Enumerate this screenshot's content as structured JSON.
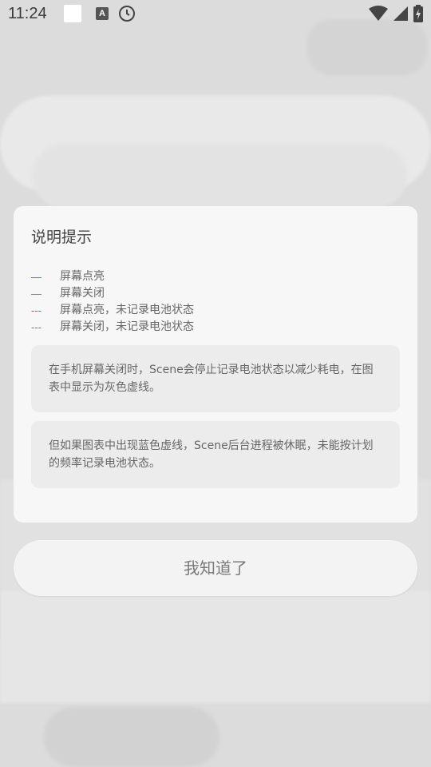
{
  "status_bar": {
    "time": "11:24",
    "a_icon_label": "A"
  },
  "dialog": {
    "title": "说明提示",
    "legend": [
      {
        "line": "—",
        "color": "#3b78d6",
        "label": "屏幕点亮"
      },
      {
        "line": "—",
        "color": "#777777",
        "label": "屏幕关闭"
      },
      {
        "line": "---",
        "color": "#3b78d6",
        "label": "屏幕点亮，未记录电池状态"
      },
      {
        "line": "---",
        "color": "#777777",
        "label": "屏幕关闭，未记录电池状态"
      }
    ],
    "info_1": "在手机屏幕关闭时，Scene会停止记录电池状态以减少耗电，在图表中显示为灰色虚线。",
    "info_2": "但如果图表中出现蓝色虚线，Scene后台进程被休眠，未能按计划的频率记录电池状态。"
  },
  "confirm_button": {
    "label": "我知道了"
  }
}
